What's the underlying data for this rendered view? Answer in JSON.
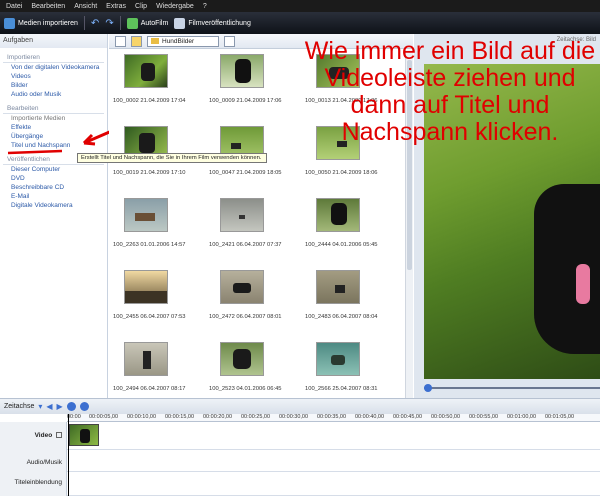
{
  "menu": [
    "Datei",
    "Bearbeiten",
    "Ansicht",
    "Extras",
    "Clip",
    "Wiedergabe",
    "?"
  ],
  "toolbar": {
    "import_label": "Medien importieren",
    "autofilm_label": "AutoFilm",
    "publish_label": "Filmveröffentlichung"
  },
  "tasks": {
    "header": "Aufgaben",
    "sections": [
      {
        "title": "Importieren",
        "items": [
          "Von der digitalen Videokamera",
          "Videos",
          "Bilder",
          "Audio oder Musik"
        ]
      },
      {
        "title": "Bearbeiten",
        "items": [
          "Importierte Medien",
          "Effekte",
          "Übergänge",
          "Titel und Nachspann"
        ]
      },
      {
        "title": "Veröffentlichen",
        "items": [
          "Dieser Computer",
          "DVD",
          "Beschreibbare CD",
          "E-Mail",
          "Digitale Videokamera"
        ]
      }
    ]
  },
  "gallery": {
    "folder": "HundBilder",
    "items": [
      "100_0002 21.04.2009 17:04",
      "100_0009 21.04.2009 17:06",
      "100_0013 21.04.2009 17:06",
      "100_0019 21.04.2009 17:10",
      "100_0047 21.04.2009 18:05",
      "100_0050 21.04.2009 18:06",
      "100_2263 01.01.2006 14:57",
      "100_2421 06.04.2007 07:37",
      "100_2444 04.01.2006 05:45",
      "100_2455 06.04.2007 07:53",
      "100_2472 06.04.2007 08:01",
      "100_2483 06.04.2007 08:04",
      "100_2494 06.04.2007 08:17",
      "100_2523 04.01.2006 06:45",
      "100_2566 25.04.2007 08:31"
    ]
  },
  "tooltip": "Erstellt Titel und Nachspann, die Sie in Ihrem Film verwenden können.",
  "preview_header": "Zeitachse: Bild",
  "annotation": "Wie immer ein Bild auf die Videoleiste ziehen und dann auf Titel und Nachspann klicken.",
  "timeline": {
    "label": "Zeitachse",
    "ticks": [
      "00:00",
      "00:00:05,00",
      "00:00:10,00",
      "00:00:15,00",
      "00:00:20,00",
      "00:00:25,00",
      "00:00:30,00",
      "00:00:35,00",
      "00:00:40,00",
      "00:00:45,00",
      "00:00:50,00",
      "00:00:55,00",
      "00:01:00,00",
      "00:01:05,00"
    ],
    "tracks": [
      "Video",
      "Audio/Musik",
      "Titeleinblendung"
    ]
  },
  "colors": {
    "annotation": "#e00000",
    "link": "#2c5aa8"
  },
  "icons": [
    "import-icon",
    "undo-icon",
    "redo-icon",
    "autofilm-icon",
    "publish-icon",
    "folder-icon",
    "zoom-in-icon",
    "zoom-out-icon",
    "play-icon"
  ]
}
